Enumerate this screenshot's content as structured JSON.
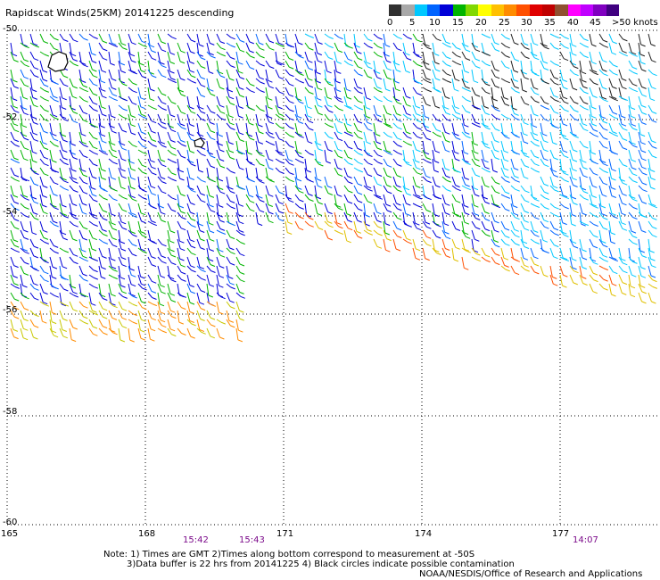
{
  "title": "Rapidscat Winds(25KM) 20141225 descending",
  "legend": {
    "labels": [
      "0",
      "5",
      "10",
      "15",
      "20",
      "25",
      "30",
      "35",
      "40",
      "45",
      ">50 knots"
    ],
    "colors": [
      "#303030",
      "#a8a8a8",
      "#00c8ff",
      "#0064ff",
      "#0000d8",
      "#00b400",
      "#80d800",
      "#ffff00",
      "#ffc000",
      "#ff8c00",
      "#ff5000",
      "#e00000",
      "#c00000",
      "#905030",
      "#ff00ff",
      "#c000ff",
      "#8000c0",
      "#400080"
    ]
  },
  "lat_labels": [
    "-50",
    "-52",
    "-54",
    "-56",
    "-58",
    "-60"
  ],
  "lon_labels": [
    "165",
    "168",
    "171",
    "174",
    "177"
  ],
  "times": [
    "15:42",
    "15:43",
    "14:07"
  ],
  "notes": {
    "line1": "Note: 1) Times are GMT 2)Times along bottom correspond to measurement at -50S",
    "line2": "3)Data buffer is 22 hrs from 20141225 4) Black circles indicate possible contamination",
    "credit": "NOAA/NESDIS/Office of Research and Applications"
  }
}
